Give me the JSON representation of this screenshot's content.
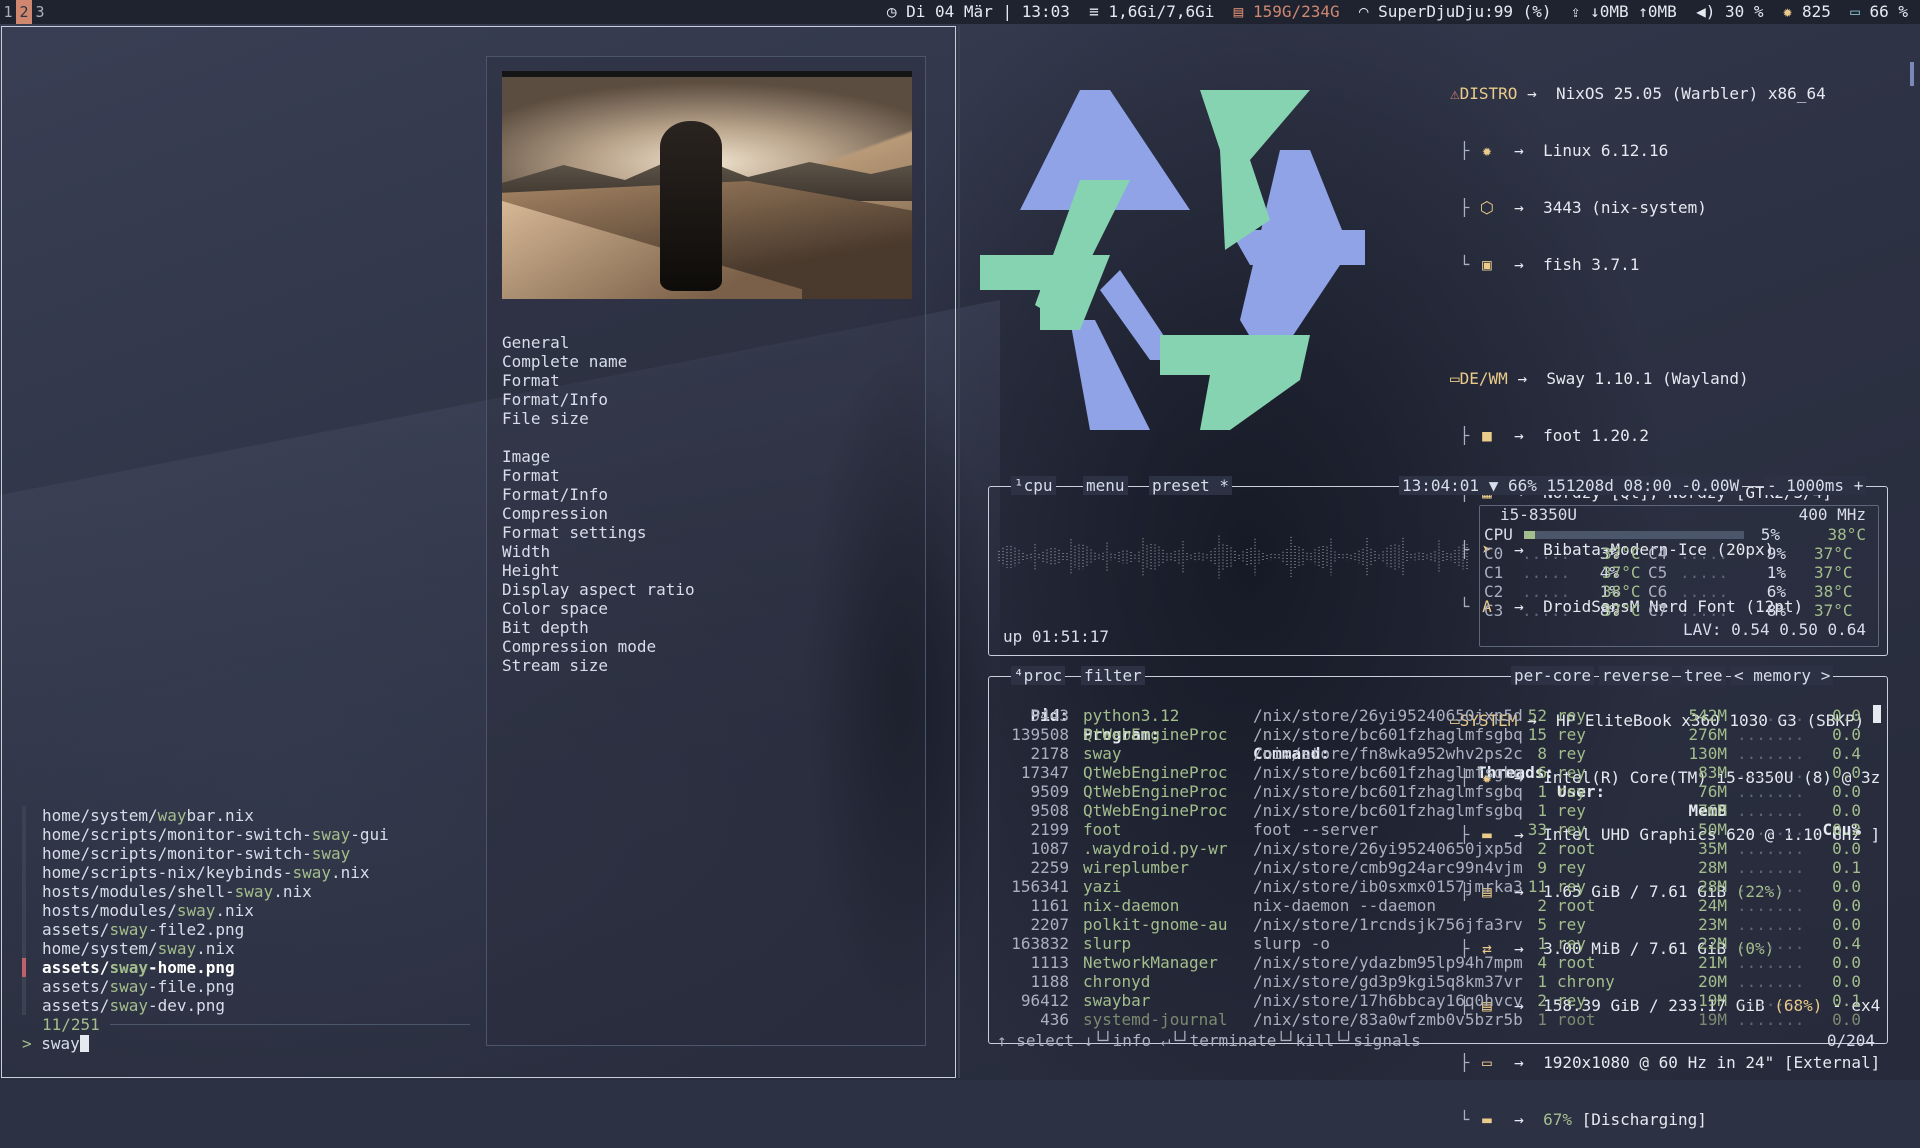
{
  "topbar": {
    "workspaces": [
      "1",
      "2",
      "3"
    ],
    "active_workspace": "2",
    "clock_icon": "clock-icon",
    "date": "Di 04 Mär",
    "time": "13:03",
    "memory": "1,6Gi/7,6Gi",
    "disk": "159G/234G",
    "wifi": "SuperDjuDju:99 (%)",
    "net_down": "↓0MB",
    "net_up": "↑0MB",
    "volume": "30 %",
    "temperature": "825",
    "battery": "66 %"
  },
  "preview": {
    "info_lines": [
      "General",
      "Complete name",
      "Format",
      "Format/Info",
      "File size",
      "",
      "Image",
      "Format",
      "Format/Info",
      "Compression",
      "Format settings",
      "Width",
      "Height",
      "Display aspect ratio",
      "Color space",
      "Bit depth",
      "Compression mode",
      "Stream size"
    ]
  },
  "finder": {
    "items": [
      {
        "pre": "home/system/",
        "match": "way",
        "post": "bar.nix"
      },
      {
        "pre": "home/scripts/monitor-switch-",
        "match": "sway",
        "post": "-gui"
      },
      {
        "pre": "home/scripts/monitor-switch-",
        "match": "sway",
        "post": ""
      },
      {
        "pre": "home/scripts-nix/keybinds-",
        "match": "sway",
        "post": ".nix"
      },
      {
        "pre": "hosts/modules/shell-",
        "match": "sway",
        "post": ".nix"
      },
      {
        "pre": "hosts/modules/",
        "match": "sway",
        "post": ".nix"
      },
      {
        "pre": "assets/",
        "match": "sway",
        "post": "-file2.png"
      },
      {
        "pre": "home/system/",
        "match": "sway",
        "post": ".nix"
      },
      {
        "pre": "assets/",
        "match": "sway",
        "post": "-home.png"
      },
      {
        "pre": "assets/",
        "match": "sway",
        "post": "-file.png"
      },
      {
        "pre": "assets/",
        "match": "sway",
        "post": "-dev.png"
      }
    ],
    "selected_index": 8,
    "count": "11/251",
    "prompt_symbol": ">",
    "query": "sway"
  },
  "fastfetch": {
    "distro_label": "DISTRO",
    "distro": "NixOS 25.05 (Warbler) x86_64",
    "kernel": "Linux 6.12.16",
    "packages": "3443 (nix-system)",
    "shell": "fish 3.7.1",
    "dewm_label": "DE/WM",
    "wm": "Sway 1.10.1 (Wayland)",
    "terminal": "foot 1.20.2",
    "theme": "Nordzy [Qt], Nordzy [GTK2/3/4]",
    "cursor": "Bibata-Modern-Ice (20px)",
    "font": "DroidSansM Nerd Font (12pt)",
    "system_label": "SYSTEM",
    "host": "HP EliteBook x360 1030 G3 (SBKP)",
    "cpu": "Intel(R) Core(TM) i5-8350U (8) @ 3z",
    "gpu": "Intel UHD Graphics 620 @ 1.10 GHz ]",
    "memory_used": "1.65 GiB / 7.61 GiB ",
    "memory_pct": "(22%)",
    "swap_used": "3.00 MiB / 7.61 GiB ",
    "swap_pct": "(0%)",
    "disk_used": "158.39 GiB / 233.17 GiB ",
    "disk_pct": "(68%)",
    "disk_fs": " - ex4",
    "display": "1920x1080 @ 60 Hz in 24\" [External]",
    "battery_pct": "67%",
    "battery_state": " [Discharging]",
    "arrow": "→"
  },
  "btop": {
    "cpu_tab": "¹cpu",
    "menu_tab": "menu",
    "preset_tab": "preset *",
    "header_status": "13:04:01 ▼ 66% 151208d 08:00 -0.00W",
    "update_ms": "- 1000ms +",
    "cpu_model": "i5-8350U",
    "cpu_freq": "400 MHz",
    "cpu_total_label": "CPU",
    "cpu_total_pct": "5%",
    "cpu_total_temp": "38°C",
    "cpu_total_fill": 0.05,
    "cores": [
      {
        "name": "C0",
        "pct": "3%",
        "temp": "37°C",
        "name2": "C4",
        "pct2": "9%",
        "temp2": "37°C"
      },
      {
        "name": "C1",
        "pct": "4%",
        "temp": "37°C",
        "name2": "C5",
        "pct2": "1%",
        "temp2": "37°C"
      },
      {
        "name": "C2",
        "pct": "1%",
        "temp": "38°C",
        "name2": "C6",
        "pct2": "6%",
        "temp2": "38°C"
      },
      {
        "name": "C3",
        "pct": "8%",
        "temp": "37°C",
        "name2": "C7",
        "pct2": "8%",
        "temp2": "37°C"
      }
    ],
    "load_avg": "LAV: 0.54 0.50 0.64",
    "uptime": "up 01:51:17",
    "proc_tab": "⁴proc",
    "filter_tab": "filter",
    "per_core": "per-core",
    "reverse": "reverse",
    "tree": "tree",
    "sort_by": "< memory >",
    "headers": {
      "pid": "Pid:",
      "program": "Program:",
      "command": "Command:",
      "threads": "Threads:",
      "user": "User:",
      "mem": "MemB",
      "cpu": "Cpu%"
    },
    "processes": [
      {
        "pid": "9443",
        "program": "python3.12",
        "command": "/nix/store/26yi95240650jxp5d",
        "threads": "52",
        "user": "rey",
        "mem": "542M",
        "cpu": "0.0"
      },
      {
        "pid": "139508",
        "program": "QtWebEngineProc",
        "command": "/nix/store/bc601fzhaglmfsgbq",
        "threads": "15",
        "user": "rey",
        "mem": "276M",
        "cpu": "0.0"
      },
      {
        "pid": "2178",
        "program": "sway",
        "command": "/nix/store/fn8wka952whv2ps2c",
        "threads": "8",
        "user": "rey",
        "mem": "130M",
        "cpu": "0.4"
      },
      {
        "pid": "17347",
        "program": "QtWebEngineProc",
        "command": "/nix/store/bc601fzhaglmfsgbq",
        "threads": "6",
        "user": "rey",
        "mem": "83M",
        "cpu": "0.0"
      },
      {
        "pid": "9509",
        "program": "QtWebEngineProc",
        "command": "/nix/store/bc601fzhaglmfsgbq",
        "threads": "1",
        "user": "rey",
        "mem": "76M",
        "cpu": "0.0"
      },
      {
        "pid": "9508",
        "program": "QtWebEngineProc",
        "command": "/nix/store/bc601fzhaglmfsgbq",
        "threads": "1",
        "user": "rey",
        "mem": "76M",
        "cpu": "0.0"
      },
      {
        "pid": "2199",
        "program": "foot",
        "command": "foot --server",
        "threads": "33",
        "user": "rey",
        "mem": "50M",
        "cpu": "0.2"
      },
      {
        "pid": "1087",
        "program": ".waydroid.py-wr",
        "command": "/nix/store/26yi95240650jxp5d",
        "threads": "2",
        "user": "root",
        "mem": "35M",
        "cpu": "0.0"
      },
      {
        "pid": "2259",
        "program": "wireplumber",
        "command": "/nix/store/cmb9g24arc99n4vjm",
        "threads": "9",
        "user": "rey",
        "mem": "28M",
        "cpu": "0.1"
      },
      {
        "pid": "156341",
        "program": "yazi",
        "command": "/nix/store/ib0sxmx0157jmrka3",
        "threads": "11",
        "user": "rey",
        "mem": "28M",
        "cpu": "0.0"
      },
      {
        "pid": "1161",
        "program": "nix-daemon",
        "command": "nix-daemon --daemon",
        "threads": "2",
        "user": "root",
        "mem": "24M",
        "cpu": "0.0"
      },
      {
        "pid": "2207",
        "program": "polkit-gnome-au",
        "command": "/nix/store/1rcndsjk756jfa3rv",
        "threads": "5",
        "user": "rey",
        "mem": "23M",
        "cpu": "0.0"
      },
      {
        "pid": "163832",
        "program": "slurp",
        "command": "slurp -o",
        "threads": "1",
        "user": "rey",
        "mem": "22M",
        "cpu": "0.4"
      },
      {
        "pid": "1113",
        "program": "NetworkManager",
        "command": "/nix/store/ydazbm95lp94h7mpm",
        "threads": "4",
        "user": "root",
        "mem": "21M",
        "cpu": "0.0"
      },
      {
        "pid": "1188",
        "program": "chronyd",
        "command": "/nix/store/gd3p9kgi5q8km37vr",
        "threads": "1",
        "user": "chrony",
        "mem": "20M",
        "cpu": "0.0"
      },
      {
        "pid": "96412",
        "program": "swaybar",
        "command": "/nix/store/17h6bbcay16q0hvcv",
        "threads": "2",
        "user": "rey",
        "mem": "19M",
        "cpu": "0.1"
      },
      {
        "pid": "436",
        "program": "systemd-journal",
        "command": "/nix/store/83a0wfzmb0v5bzr5b",
        "threads": "1",
        "user": "root",
        "mem": "19M",
        "cpu": "0.0"
      }
    ],
    "bottom": "↑ select ↓└┘info ↵└┘terminate└┘kill└┘signals",
    "proc_count": "0/204"
  },
  "colors": {
    "accent_green": "#a3be8c",
    "accent_yellow": "#ebcb8b",
    "workspace_active": "#d08770",
    "logo_blue": "#8fa3e6",
    "logo_teal": "#86d3b2"
  }
}
